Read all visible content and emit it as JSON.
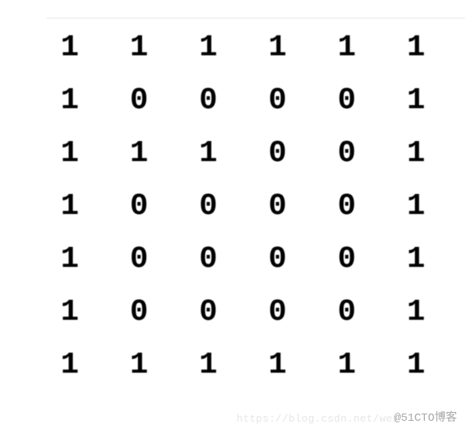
{
  "matrix": {
    "rows": [
      [
        "1",
        "1",
        "1",
        "1",
        "1",
        "1"
      ],
      [
        "1",
        "0",
        "0",
        "0",
        "0",
        "1"
      ],
      [
        "1",
        "1",
        "1",
        "0",
        "0",
        "1"
      ],
      [
        "1",
        "0",
        "0",
        "0",
        "0",
        "1"
      ],
      [
        "1",
        "0",
        "0",
        "0",
        "0",
        "1"
      ],
      [
        "1",
        "0",
        "0",
        "0",
        "0",
        "1"
      ],
      [
        "1",
        "1",
        "1",
        "1",
        "1",
        "1"
      ]
    ]
  },
  "watermark": {
    "light": "https://blog.csdn.net/wei",
    "dark": "@51CTO博客"
  },
  "chart_data": {
    "type": "table",
    "title": "",
    "rows": 7,
    "cols": 6,
    "values": [
      [
        1,
        1,
        1,
        1,
        1,
        1
      ],
      [
        1,
        0,
        0,
        0,
        0,
        1
      ],
      [
        1,
        1,
        1,
        0,
        0,
        1
      ],
      [
        1,
        0,
        0,
        0,
        0,
        1
      ],
      [
        1,
        0,
        0,
        0,
        0,
        1
      ],
      [
        1,
        0,
        0,
        0,
        0,
        1
      ],
      [
        1,
        1,
        1,
        1,
        1,
        1
      ]
    ]
  }
}
